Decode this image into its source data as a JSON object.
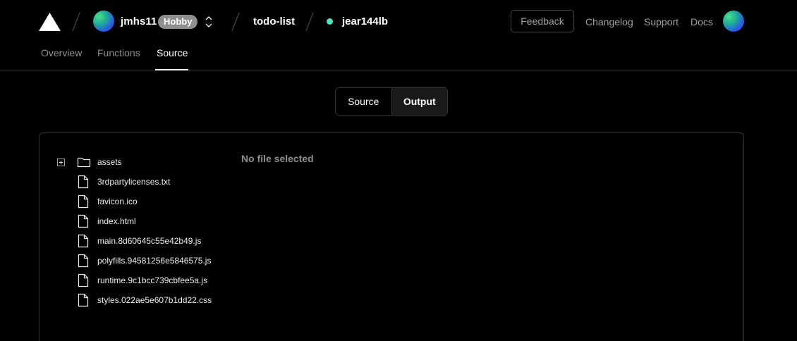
{
  "header": {
    "team_name": "jmhs11",
    "plan_badge": "Hobby",
    "project_name": "todo-list",
    "deployment_id": "jear144lb",
    "status_color": "#50e3c2",
    "links": {
      "feedback": "Feedback",
      "changelog": "Changelog",
      "support": "Support",
      "docs": "Docs"
    }
  },
  "tabs": [
    {
      "label": "Overview",
      "active": false
    },
    {
      "label": "Functions",
      "active": false
    },
    {
      "label": "Source",
      "active": true
    }
  ],
  "view_toggle": {
    "source_label": "Source",
    "output_label": "Output",
    "selected": "Output"
  },
  "file_tree": [
    {
      "name": "assets",
      "type": "folder",
      "icon": "folder-icon",
      "expandable": true
    },
    {
      "name": "3rdpartylicenses.txt",
      "type": "file",
      "icon": "file-icon"
    },
    {
      "name": "favicon.ico",
      "type": "file",
      "icon": "file-icon"
    },
    {
      "name": "index.html",
      "type": "file",
      "icon": "file-icon"
    },
    {
      "name": "main.8d60645c55e42b49.js",
      "type": "file",
      "icon": "file-icon"
    },
    {
      "name": "polyfills.94581256e5846575.js",
      "type": "file",
      "icon": "file-icon"
    },
    {
      "name": "runtime.9c1bcc739cbfee5a.js",
      "type": "file",
      "icon": "file-icon"
    },
    {
      "name": "styles.022ae5e607b1dd22.css",
      "type": "file",
      "icon": "file-icon"
    }
  ],
  "preview": {
    "empty_message": "No file selected"
  }
}
